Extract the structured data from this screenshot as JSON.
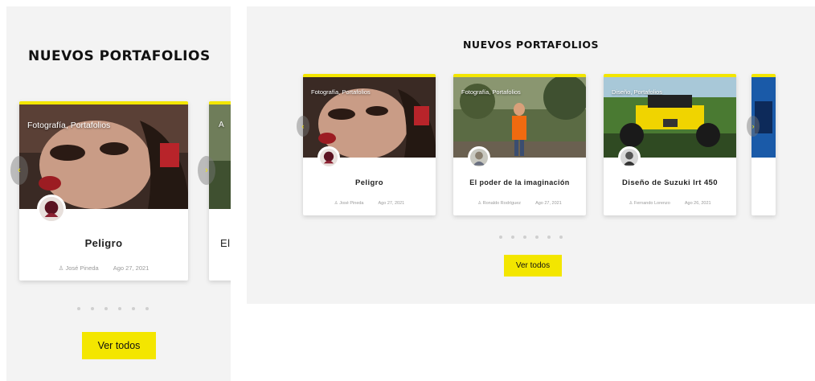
{
  "section_title": "NUEVOS PORTAFOLIOS",
  "view_all_label": "Ver todos",
  "cards": [
    {
      "category": "Fotografía, Portafolios",
      "title": "Peligro",
      "author": "José Pineda",
      "date": "Ago 27, 2021"
    },
    {
      "category": "Fotografía, Portafolios",
      "title": "El poder de la imaginación",
      "author": "Ronaldo Rodríguez",
      "date": "Ago 27, 2021"
    },
    {
      "category": "Diseño, Portafolios",
      "title": "Diseño de Suzuki lrt 450",
      "author": "Fernando Lorenzo",
      "date": "Ago 26, 2021"
    }
  ],
  "left_peek_title": "El",
  "left_peek_category": "A",
  "dots_count": 6,
  "colors": {
    "accent": "#f3e600",
    "panel_bg": "#f3f3f3"
  },
  "icons": {
    "author": "user-icon",
    "prev": "chevron-left-icon",
    "next": "chevron-right-icon"
  }
}
